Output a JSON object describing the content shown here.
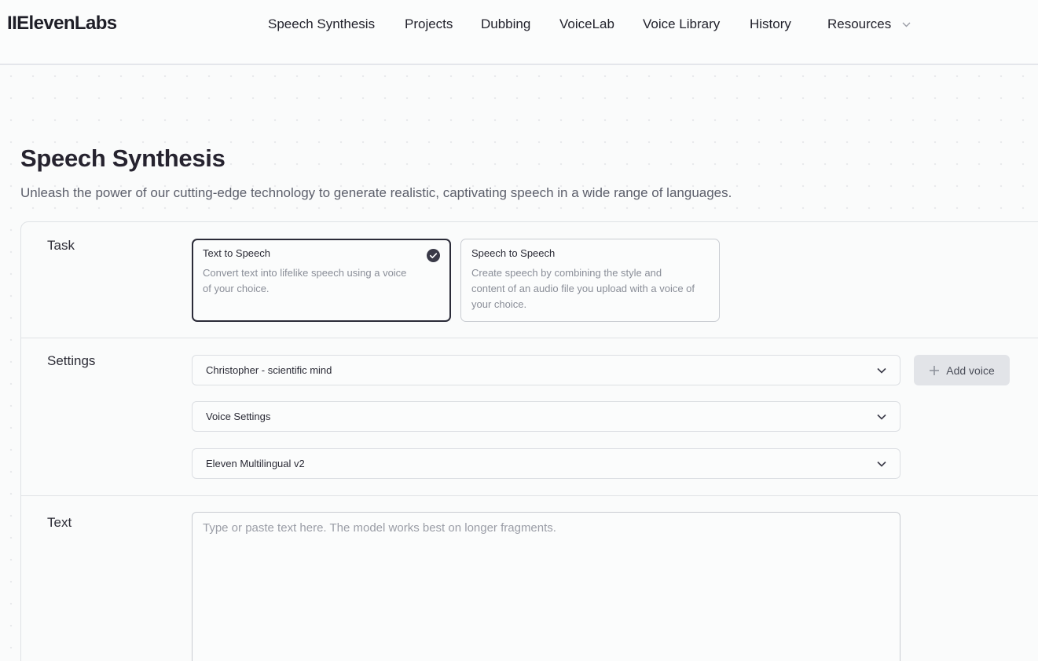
{
  "brand": {
    "logo": "IIElevenLabs"
  },
  "nav": {
    "items": [
      {
        "label": "Speech Synthesis"
      },
      {
        "label": "Projects"
      },
      {
        "label": "Dubbing"
      },
      {
        "label": "VoiceLab"
      },
      {
        "label": "Voice Library"
      },
      {
        "label": "History"
      },
      {
        "label": "Resources"
      }
    ]
  },
  "page": {
    "title": "Speech Synthesis",
    "subtitle": "Unleash the power of our cutting-edge technology to generate realistic, captivating speech in a wide range of languages."
  },
  "task": {
    "label": "Task",
    "options": [
      {
        "title": "Text to Speech",
        "description": "Convert text into lifelike speech using a voice of your choice.",
        "selected": true
      },
      {
        "title": "Speech to Speech",
        "description": "Create speech by combining the style and content of an audio file you upload with a voice of your choice.",
        "selected": false
      }
    ]
  },
  "settings": {
    "label": "Settings",
    "voice": "Christopher - scientific mind",
    "voice_settings": "Voice Settings",
    "model": "Eleven Multilingual v2",
    "add_voice_label": "Add voice"
  },
  "text": {
    "label": "Text",
    "placeholder": "Type or paste text here. The model works best on longer fragments.",
    "value": ""
  },
  "colors": {
    "accent": "#2b2b38",
    "border": "#dfe2e5",
    "muted_text": "#8a8e98",
    "button_bg": "#e2e4e8"
  }
}
